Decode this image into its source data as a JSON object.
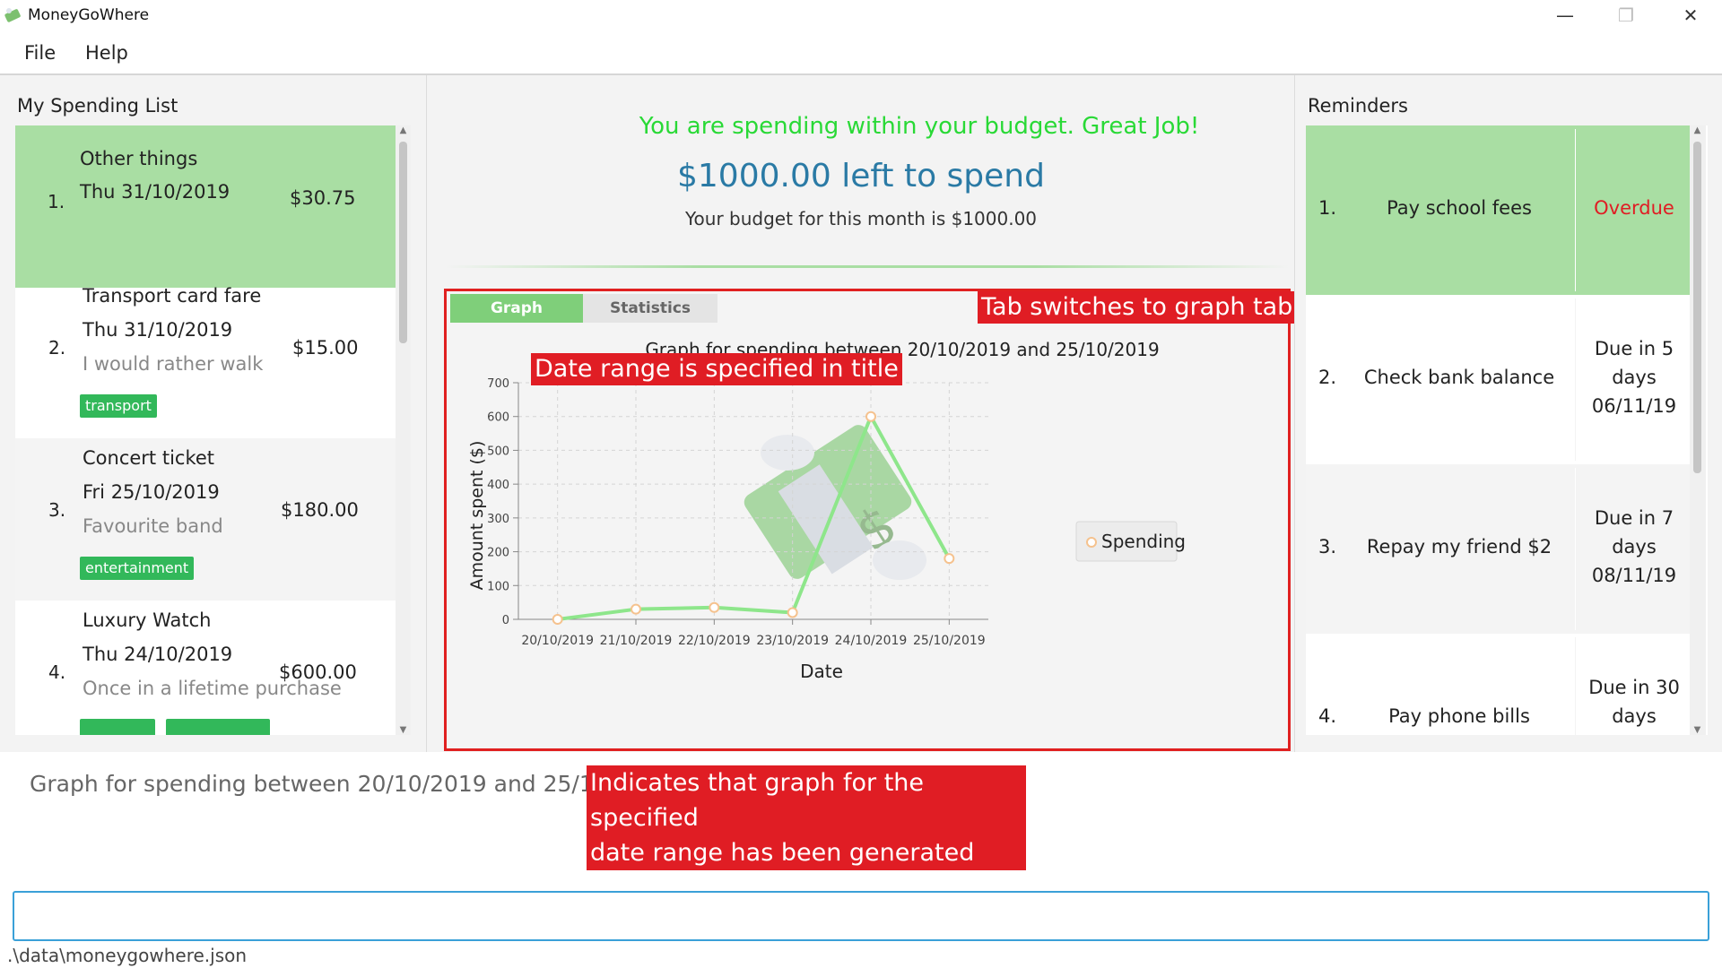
{
  "window": {
    "title": "MoneyGoWhere"
  },
  "menu": {
    "file": "File",
    "help": "Help"
  },
  "spending": {
    "title": "My Spending List",
    "items": [
      {
        "index": "1.",
        "name": "Other things",
        "date": "Thu 31/10/2019",
        "amount": "$30.75",
        "note": "",
        "tags": []
      },
      {
        "index": "2.",
        "name": "Transport card fare",
        "date": "Thu 31/10/2019",
        "amount": "$15.00",
        "note": "I would rather walk",
        "tags": [
          "transport"
        ]
      },
      {
        "index": "3.",
        "name": "Concert ticket",
        "date": "Fri 25/10/2019",
        "amount": "$180.00",
        "note": "Favourite band",
        "tags": [
          "entertainment"
        ]
      },
      {
        "index": "4.",
        "name": "Luxury Watch",
        "date": "Thu 24/10/2019",
        "amount": "$600.00",
        "note": "Once in a lifetime purchase",
        "tags": [
          "",
          ""
        ]
      }
    ]
  },
  "budget": {
    "status": "You are spending within your budget. Great Job!",
    "remaining": "$1000.00 left to spend",
    "monthly": "Your budget for this month is $1000.00"
  },
  "tabs": {
    "graph": "Graph",
    "statistics": "Statistics",
    "active": "Graph"
  },
  "chart_data": {
    "type": "line",
    "title": "Graph for spending between 20/10/2019 and 25/10/2019",
    "xlabel": "Date",
    "ylabel": "Amount spent ($)",
    "categories": [
      "20/10/2019",
      "21/10/2019",
      "22/10/2019",
      "23/10/2019",
      "24/10/2019",
      "25/10/2019"
    ],
    "series": [
      {
        "name": "Spending",
        "values": [
          0,
          30,
          35,
          20,
          600,
          180
        ]
      }
    ],
    "ylim": [
      0,
      700
    ],
    "yticks": [
      0,
      100,
      200,
      300,
      400,
      500,
      600,
      700
    ],
    "grid": true,
    "legend": "right",
    "line_color": "#8ee68b",
    "marker_color": "#f5c28e"
  },
  "callouts": {
    "tab": "Tab switches to graph tab",
    "title": "Date range is specified in title",
    "result_line1": "Indicates that graph for the specified",
    "result_line2": "date range has been generated"
  },
  "reminders": {
    "title": "Reminders",
    "items": [
      {
        "index": "1.",
        "name": "Pay school fees",
        "due": [
          "Overdue"
        ],
        "overdue": true
      },
      {
        "index": "2.",
        "name": "Check bank balance",
        "due": [
          "Due in 5",
          "days",
          "06/11/19"
        ],
        "overdue": false
      },
      {
        "index": "3.",
        "name": "Repay my friend $2",
        "due": [
          "Due in 7",
          "days",
          "08/11/19"
        ],
        "overdue": false
      },
      {
        "index": "4.",
        "name": "Pay phone bills",
        "due": [
          "Due in 30",
          "days"
        ],
        "overdue": false
      }
    ]
  },
  "result": {
    "text": "Graph for spending between 20/10/2019 and 25/10/2019"
  },
  "command": {
    "value": "",
    "placeholder": ""
  },
  "status": {
    "path": ".\\data\\moneygowhere.json"
  },
  "colors": {
    "accent_green": "#a9dea3",
    "tag_green": "#32b85a",
    "callout_red": "#e01d24",
    "budget_ok": "#29d936",
    "budget_left": "#2a7aa5"
  }
}
